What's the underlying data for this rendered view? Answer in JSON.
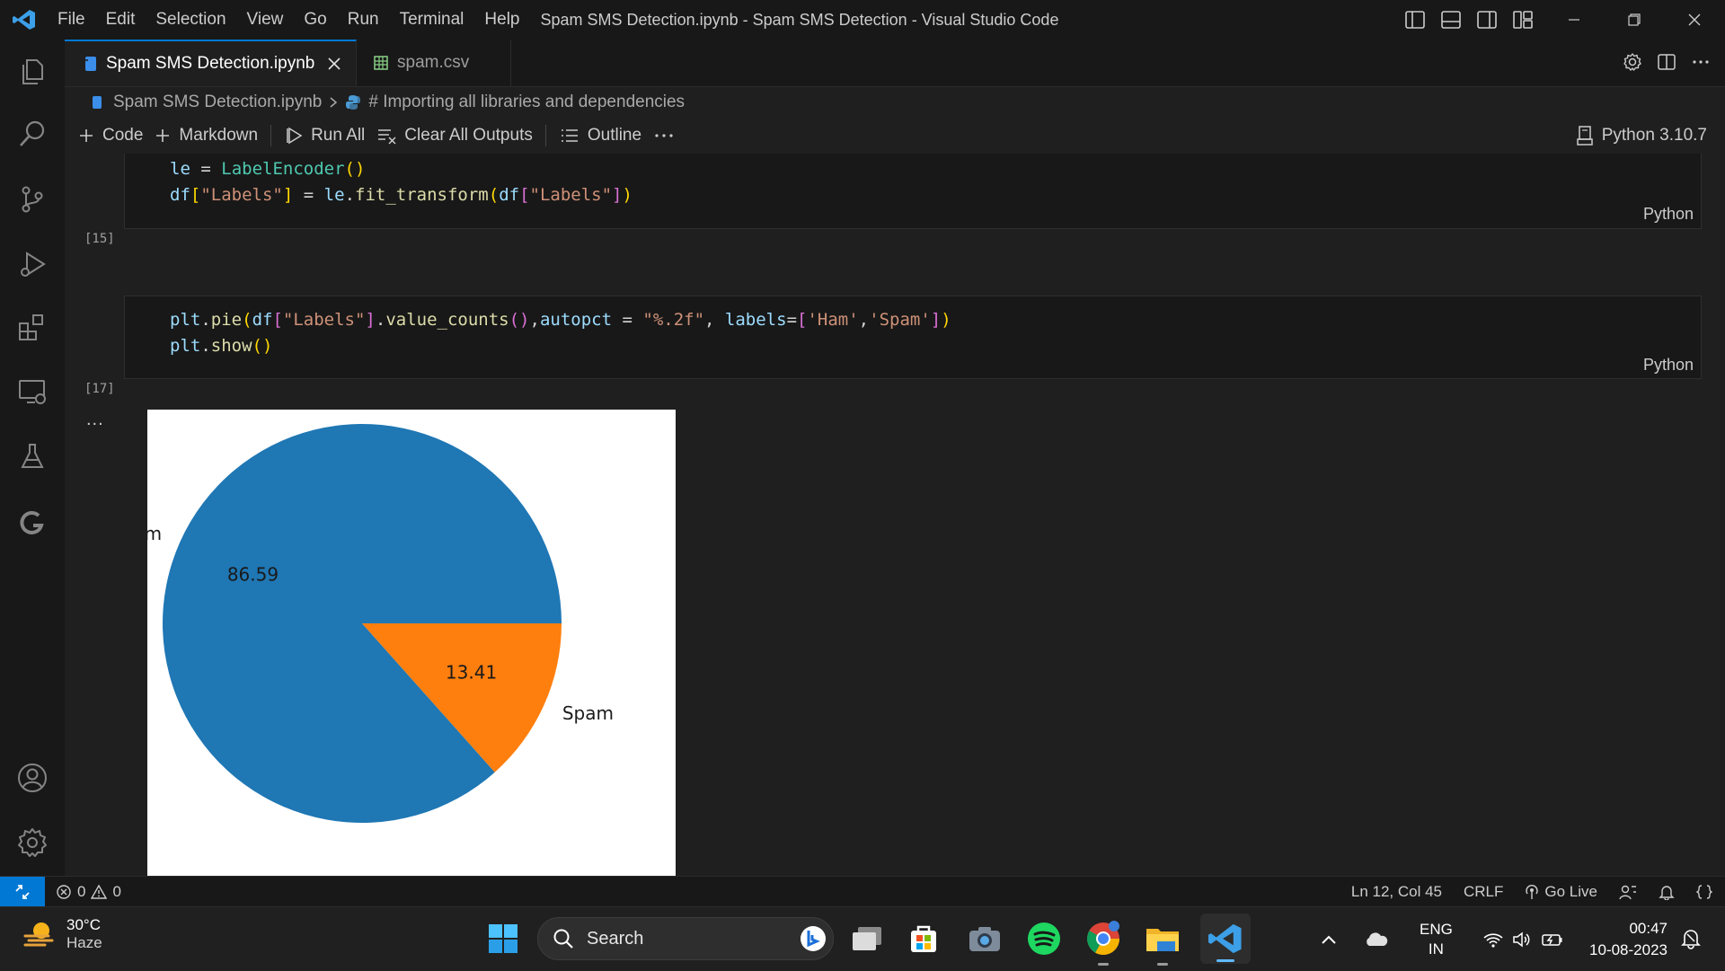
{
  "window": {
    "title": "Spam SMS Detection.ipynb - Spam SMS Detection - Visual Studio Code",
    "menu": [
      "File",
      "Edit",
      "Selection",
      "View",
      "Go",
      "Run",
      "Terminal",
      "Help"
    ]
  },
  "tabs": [
    {
      "label": "Spam SMS Detection.ipynb",
      "active": true
    },
    {
      "label": "spam.csv",
      "active": false
    }
  ],
  "breadcrumb": {
    "file": "Spam SMS Detection.ipynb",
    "section": "# Importing all libraries and dependencies"
  },
  "toolbar": {
    "code": "Code",
    "markdown": "Markdown",
    "run_all": "Run All",
    "clear_outputs": "Clear All Outputs",
    "outline": "Outline",
    "kernel": "Python 3.10.7"
  },
  "cells": [
    {
      "exec_count": "[15]",
      "language": "Python",
      "lines": [
        "le = LabelEncoder()",
        "df[\"Labels\"] = le.fit_transform(df[\"Labels\"])"
      ]
    },
    {
      "exec_count": "[17]",
      "language": "Python",
      "lines": [
        "plt.pie(df[\"Labels\"].value_counts(),autopct = \"%.2f\", labels=['Ham','Spam'])",
        "plt.show()"
      ]
    }
  ],
  "output_more": "...",
  "chart_data": {
    "type": "pie",
    "categories": [
      "Ham",
      "Spam"
    ],
    "values": [
      86.59,
      13.41
    ],
    "value_labels": [
      "86.59",
      "13.41"
    ],
    "colors": [
      "#1f77b4",
      "#ff7f0e"
    ]
  },
  "statusbar": {
    "errors": "0",
    "warnings": "0",
    "position": "Ln 12, Col 45",
    "eol": "CRLF",
    "golive": "Go Live"
  },
  "taskbar": {
    "temperature": "30°C",
    "condition": "Haze",
    "search_placeholder": "Search",
    "lang_1": "ENG",
    "lang_2": "IN",
    "time": "00:47",
    "date": "10-08-2023"
  }
}
